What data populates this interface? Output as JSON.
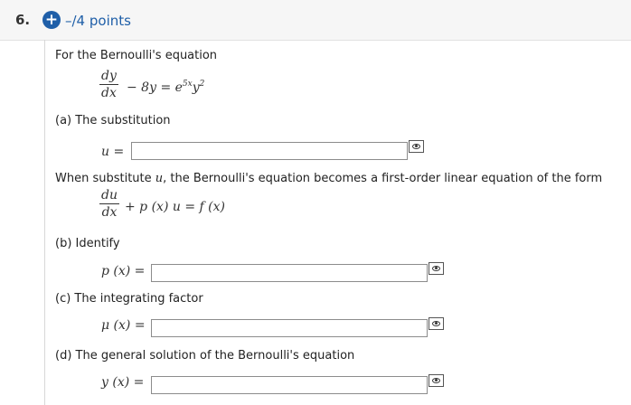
{
  "question": {
    "number": "6.",
    "points": "–/4 points",
    "plus_icon": "plus-circle-icon"
  },
  "intro": "For the Bernoulli's equation",
  "equation1": {
    "num": "dy",
    "den": "dx",
    "rhs": "− 8y = e",
    "exp": "5x",
    "tail": "y",
    "tail_exp": "2"
  },
  "part_a": {
    "label": "(a) The substitution",
    "var": "u ="
  },
  "middle": {
    "pre": "When substitute",
    "var": "u",
    "post": ", the Bernoulli's equation becomes a first-order linear equation of the form"
  },
  "equation2": {
    "num": "du",
    "den": "dx",
    "rhs": "+ p (x) u = f (x)"
  },
  "part_b": {
    "label": "(b) Identify",
    "var": "p (x) ="
  },
  "part_c": {
    "label": "(c) The integrating factor",
    "var": "μ (x) ="
  },
  "part_d": {
    "label": "(d) The general solution of the Bernoulli's equation",
    "var": "y (x) ="
  },
  "icons": {
    "preview": "eye-preview-icon"
  }
}
